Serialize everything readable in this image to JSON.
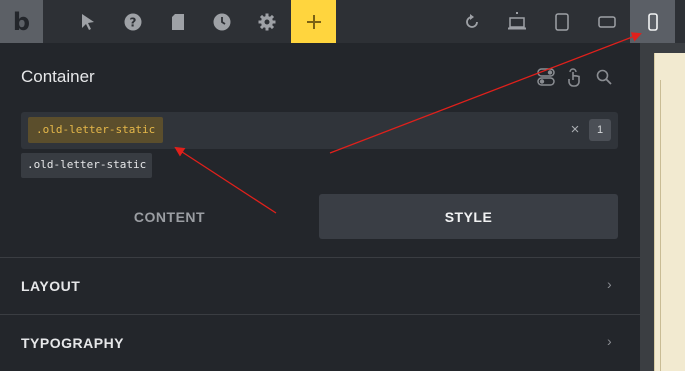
{
  "toolbar": {
    "logo": "b",
    "left_icons": [
      "cursor-icon",
      "help-icon",
      "page-icon",
      "history-icon",
      "settings-icon"
    ],
    "add_icon": "plus-icon",
    "right_icons": [
      "undo-icon",
      "laptop-icon",
      "tablet-portrait-icon",
      "tablet-landscape-icon",
      "mobile-icon"
    ],
    "accent_color": "#ffd53e"
  },
  "panel": {
    "title": "Container",
    "header_icons": [
      "toggle-icon",
      "touch-icon",
      "search-icon"
    ],
    "selector": {
      "chip": ".old-letter-static",
      "clear": "×",
      "count": "1"
    },
    "suggestion": ".old-letter-static",
    "tabs": [
      {
        "label": "CONTENT",
        "active": false
      },
      {
        "label": "STYLE",
        "active": true
      }
    ],
    "sections": [
      {
        "label": "LAYOUT",
        "chevron": "›"
      },
      {
        "label": "TYPOGRAPHY",
        "chevron": "›"
      }
    ]
  },
  "annotation_color": "#e0201b"
}
